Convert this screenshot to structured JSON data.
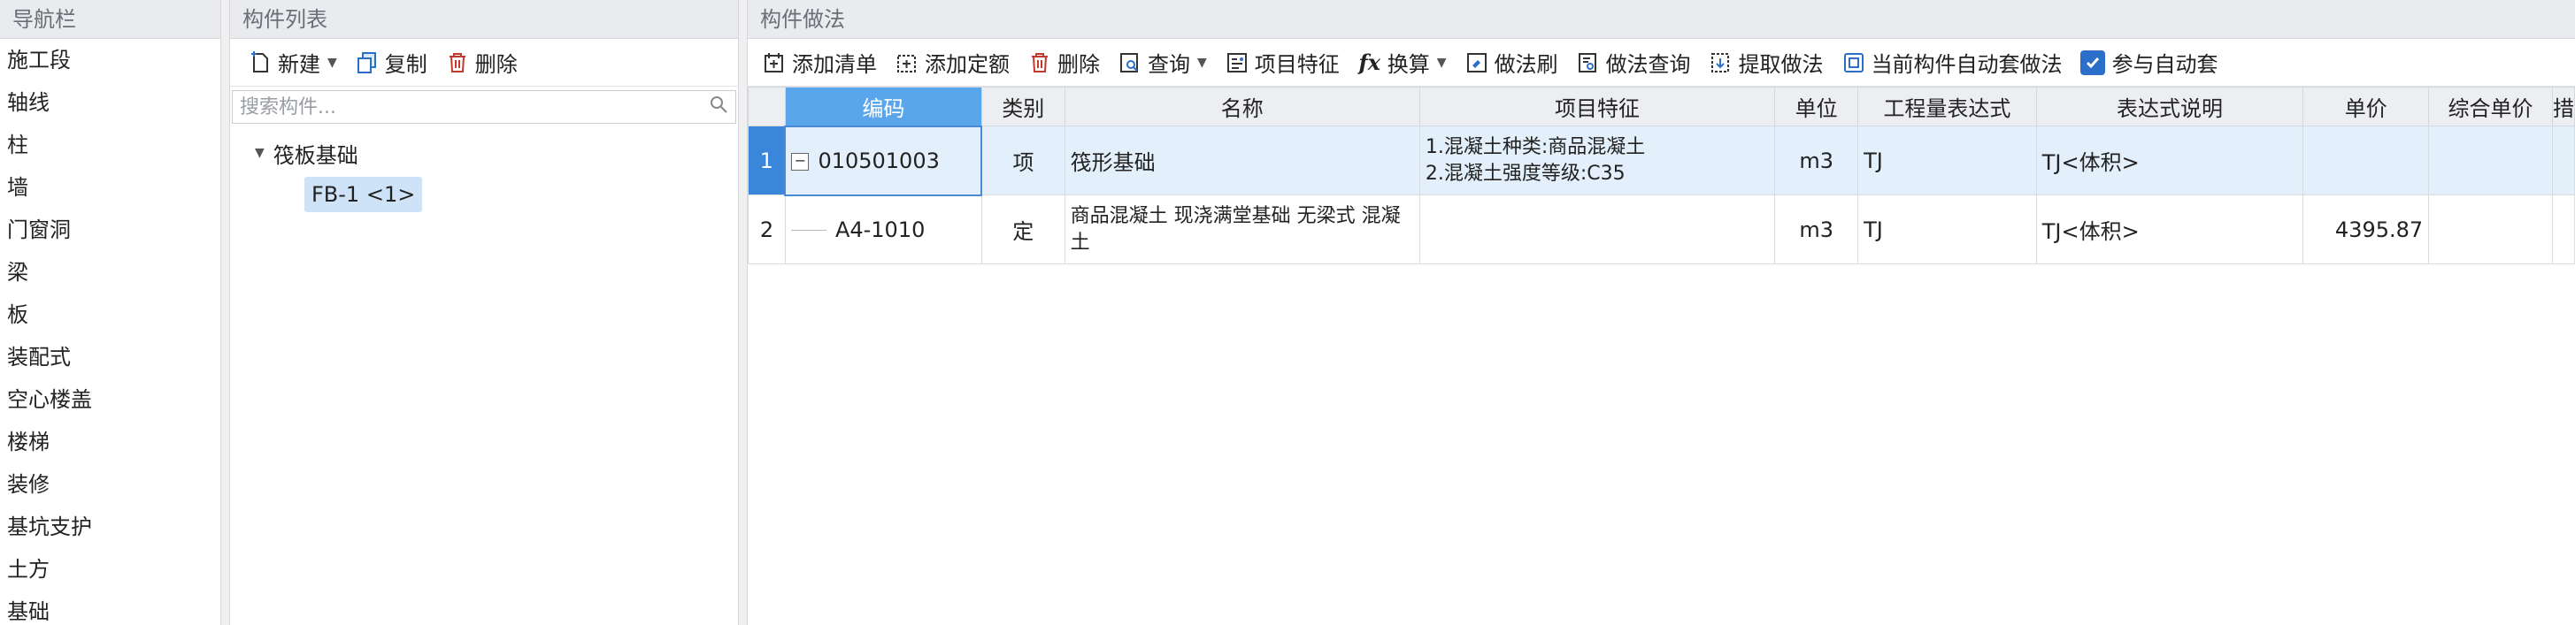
{
  "nav": {
    "title": "导航栏",
    "items": [
      "施工段",
      "轴线",
      "柱",
      "墙",
      "门窗洞",
      "梁",
      "板",
      "装配式",
      "空心楼盖",
      "楼梯",
      "装修",
      "基坑支护",
      "土方",
      "基础"
    ]
  },
  "component_list": {
    "title": "构件列表",
    "toolbar": {
      "new_label": "新建",
      "copy_label": "复制",
      "delete_label": "删除"
    },
    "search_placeholder": "搜索构件...",
    "tree": {
      "group_label": "筏板基础",
      "leaf_label": "FB-1 <1>"
    }
  },
  "method": {
    "title": "构件做法",
    "toolbar": {
      "add_list": "添加清单",
      "add_quota": "添加定额",
      "delete": "删除",
      "query": "查询",
      "feature": "项目特征",
      "convert": "换算",
      "brush": "做法刷",
      "method_query": "做法查询",
      "extract": "提取做法",
      "auto_apply": "当前构件自动套做法",
      "join_auto": "参与自动套"
    },
    "columns": [
      "编码",
      "类别",
      "名称",
      "项目特征",
      "单位",
      "工程量表达式",
      "表达式说明",
      "单价",
      "综合单价",
      "措"
    ],
    "rows": [
      {
        "index": "1",
        "code": "010501003",
        "category": "项",
        "name": "筏形基础",
        "feature_line1": "1.混凝土种类:商品混凝土",
        "feature_line2": "2.混凝土强度等级:C35",
        "unit": "m3",
        "expr": "TJ",
        "expr_desc": "TJ<体积>",
        "price": "",
        "comp_price": ""
      },
      {
        "index": "2",
        "code": "A4-1010",
        "category": "定",
        "name": "商品混凝土 现浇满堂基础 无梁式 混凝土",
        "feature_line1": "",
        "feature_line2": "",
        "unit": "m3",
        "expr": "TJ",
        "expr_desc": "TJ<体积>",
        "price": "4395.87",
        "comp_price": ""
      }
    ]
  },
  "colors": {
    "accent": "#3a86da",
    "selected_header": "#5aa6ec",
    "row_highlight": "#e3effb",
    "icon_blue": "#2b6fc9"
  }
}
